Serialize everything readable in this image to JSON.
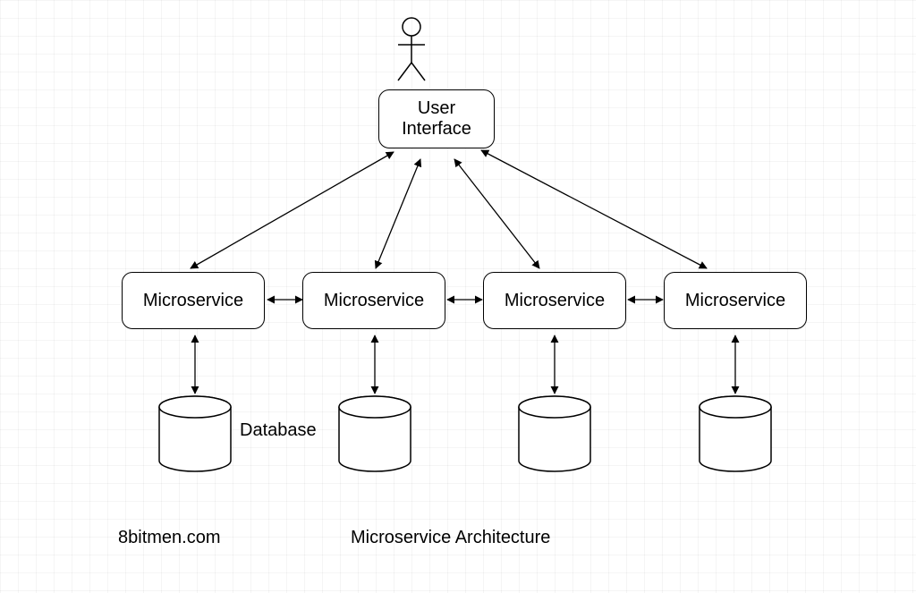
{
  "title": "Microservice Architecture",
  "attribution": "8bitmen.com",
  "ui_box": {
    "label": "User\nInterface"
  },
  "microservices": [
    {
      "label": "Microservice"
    },
    {
      "label": "Microservice"
    },
    {
      "label": "Microservice"
    },
    {
      "label": "Microservice"
    }
  ],
  "database_label": "Database",
  "actor_name": "user"
}
